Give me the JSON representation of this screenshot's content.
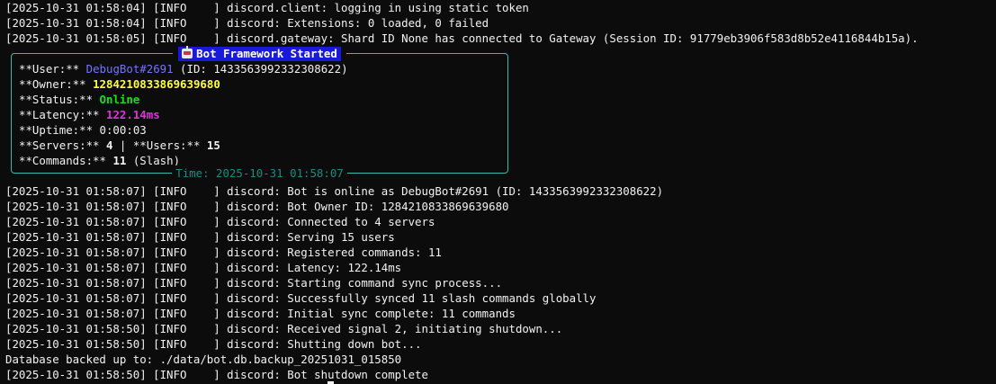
{
  "log_top": [
    "[2025-10-31 01:58:04] [INFO    ] discord.client: logging in using static token",
    "[2025-10-31 01:58:04] [INFO    ] discord: Extensions: 0 loaded, 0 failed",
    "[2025-10-31 01:58:05] [INFO    ] discord.gateway: Shard ID None has connected to Gateway (Session ID: 91779eb3906f583d8b52e4116844b15a)."
  ],
  "panel": {
    "title": "Bot Framework Started",
    "title_icon": "robot-icon",
    "footer": "Time: 2025-10-31 01:58:07",
    "user_label": "**User:** ",
    "user_value": "DebugBot#2691",
    "user_id": " (ID: 1433563992332308622)",
    "owner_label": "**Owner:** ",
    "owner_value": "1284210833869639680",
    "status_label": "**Status:** ",
    "status_value": "Online",
    "latency_label": "**Latency:** ",
    "latency_value": "122.14ms",
    "uptime_line": "**Uptime:** 0:00:03",
    "servers_label": "**Servers:** ",
    "servers_value": "4",
    "servers_sep": " | ",
    "users_label": "**Users:** ",
    "users_value": "15",
    "commands_label": "**Commands:** ",
    "commands_value": "11",
    "commands_suffix": " (Slash)"
  },
  "log_bottom": [
    "[2025-10-31 01:58:07] [INFO    ] discord: Bot is online as DebugBot#2691 (ID: 1433563992332308622)",
    "[2025-10-31 01:58:07] [INFO    ] discord: Bot Owner ID: 1284210833869639680",
    "[2025-10-31 01:58:07] [INFO    ] discord: Connected to 4 servers",
    "[2025-10-31 01:58:07] [INFO    ] discord: Serving 15 users",
    "[2025-10-31 01:58:07] [INFO    ] discord: Registered commands: 11",
    "[2025-10-31 01:58:07] [INFO    ] discord: Latency: 122.14ms",
    "[2025-10-31 01:58:07] [INFO    ] discord: Starting command sync process...",
    "[2025-10-31 01:58:07] [INFO    ] discord: Successfully synced 11 slash commands globally",
    "[2025-10-31 01:58:07] [INFO    ] discord: Initial sync complete: 11 commands",
    "[2025-10-31 01:58:50] [INFO    ] discord: Received signal 2, initiating shutdown...",
    "[2025-10-31 01:58:50] [INFO    ] discord: Shutting down bot...",
    "Database backed up to: ./data/bot.db.backup_20251031_015850",
    "[2025-10-31 01:58:50] [INFO    ] discord: Bot shutdown complete"
  ],
  "colors": {
    "background": "#0c0c0c",
    "panel_border": "#3ab7b0",
    "title_badge": "#1919d9",
    "user_name": "#7575ff",
    "owner_id": "#ffff3b",
    "status_online": "#16e016",
    "latency": "#e32fe3"
  }
}
